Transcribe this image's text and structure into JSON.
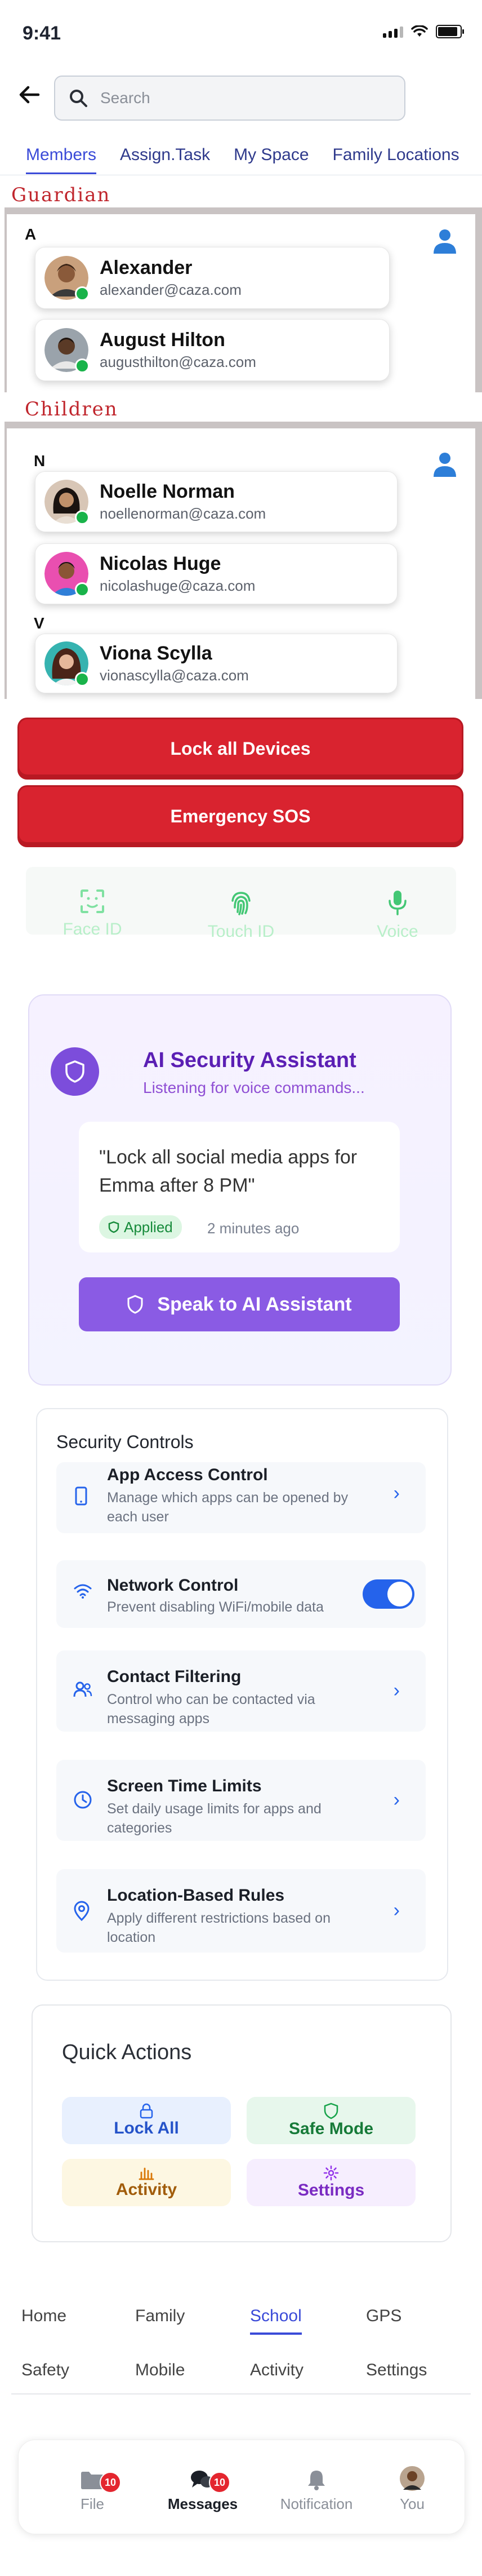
{
  "status_bar": {
    "time": "9:41"
  },
  "search": {
    "placeholder": "Search"
  },
  "tabs": [
    {
      "label": "Members",
      "active": true
    },
    {
      "label": "Assign.Task",
      "active": false
    },
    {
      "label": "My Space",
      "active": false
    },
    {
      "label": "Family Locations",
      "active": false
    }
  ],
  "guardian": {
    "section_label": "Guardian",
    "group_letter": "A",
    "members": [
      {
        "name": "Alexander",
        "email": "alexander@caza.com"
      },
      {
        "name": "August Hilton",
        "email": "augusthilton@caza.com"
      }
    ]
  },
  "children": {
    "section_label": "Children",
    "group_letter_n": "N",
    "group_letter_v": "V",
    "members": [
      {
        "name": "Noelle Norman",
        "email": "noellenorman@caza.com"
      },
      {
        "name": "Nicolas Huge",
        "email": "nicolashuge@caza.com"
      },
      {
        "name": "Viona Scylla",
        "email": "vionascylla@caza.com"
      }
    ]
  },
  "actions": {
    "lock_all_devices": "Lock all Devices",
    "emergency_sos": "Emergency SOS"
  },
  "biometrics": [
    {
      "label": "Face ID",
      "icon": "face-id-icon"
    },
    {
      "label": "Touch ID",
      "icon": "fingerprint-icon"
    },
    {
      "label": "Voice",
      "icon": "microphone-icon"
    }
  ],
  "ai_assistant": {
    "title": "AI Security Assistant",
    "subtitle": "Listening for voice commands...",
    "quote": "\"Lock all social media apps for Emma after 8 PM\"",
    "status": "Applied",
    "time": "2 minutes ago",
    "button_label": "Speak to AI Assistant"
  },
  "security_controls": {
    "title": "Security Controls",
    "items": [
      {
        "title": "App Access Control",
        "desc": "Manage which apps can be opened by each user",
        "control": "chevron"
      },
      {
        "title": "Network Control",
        "desc": "Prevent disabling WiFi/mobile data",
        "control": "toggle",
        "enabled": true
      },
      {
        "title": "Contact Filtering",
        "desc": "Control who can be contacted via messaging apps",
        "control": "chevron"
      },
      {
        "title": "Screen Time Limits",
        "desc": "Set daily usage limits for apps and categories",
        "control": "chevron"
      },
      {
        "title": "Location-Based Rules",
        "desc": "Apply different restrictions based on location",
        "control": "chevron"
      }
    ]
  },
  "quick_actions": {
    "title": "Quick Actions",
    "items": [
      {
        "label": "Lock All",
        "icon": "lock-icon",
        "color": "#2563eb"
      },
      {
        "label": "Safe Mode",
        "icon": "shield-icon",
        "color": "#15803d"
      },
      {
        "label": "Activity",
        "icon": "bar-chart-icon",
        "color": "#b45309"
      },
      {
        "label": "Settings",
        "icon": "gear-icon",
        "color": "#7e22ce"
      }
    ]
  },
  "bottom_nav_row1": [
    "Home",
    "Family",
    "School",
    "GPS"
  ],
  "bottom_nav_row2": [
    "Safety",
    "Mobile",
    "Activity",
    "Settings"
  ],
  "bottom_nav_active": "School",
  "tab_bar": [
    {
      "label": "File",
      "badge": "10",
      "icon": "folder-icon"
    },
    {
      "label": "Messages",
      "badge": "10",
      "icon": "chat-icon",
      "active": true
    },
    {
      "label": "Notification",
      "icon": "bell-icon"
    },
    {
      "label": "You",
      "icon": "avatar"
    }
  ],
  "colors": {
    "accent": "#3b4bd8",
    "danger": "#d9232f",
    "ai_purple": "#8a5be4",
    "online": "#19b34a"
  }
}
